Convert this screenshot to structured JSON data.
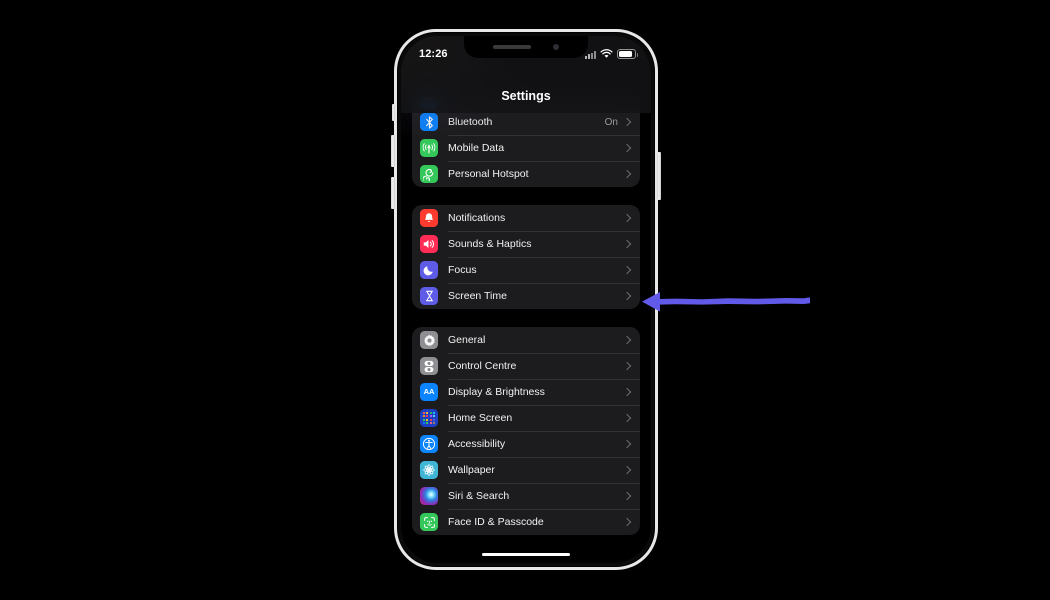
{
  "device": {
    "name": "iphone-mockup",
    "frame_color": "#e8e8e8"
  },
  "status_bar": {
    "time": "12:26",
    "signal_icon": "cellular-signal-icon",
    "wifi_icon": "wifi-icon",
    "battery_icon": "battery-icon"
  },
  "header": {
    "title": "Settings"
  },
  "groups": [
    {
      "name": "connectivity-group",
      "clipped_top": true,
      "rows": [
        {
          "label": "",
          "icon": "wifi-icon",
          "icon_class": "ic-wifi",
          "glyph": "◔",
          "value": "",
          "partial": true
        },
        {
          "label": "Bluetooth",
          "icon": "bluetooth-icon",
          "icon_class": "ic-bluetooth",
          "glyph": "ᛦ",
          "value": "On"
        },
        {
          "label": "Mobile Data",
          "icon": "mobile-data-icon",
          "icon_class": "ic-cellular",
          "glyph": "((↑))",
          "value": ""
        },
        {
          "label": "Personal Hotspot",
          "icon": "personal-hotspot-icon",
          "icon_class": "ic-hotspot",
          "glyph": "ʘ",
          "value": ""
        }
      ]
    },
    {
      "name": "notifications-group",
      "clipped_top": false,
      "rows": [
        {
          "label": "Notifications",
          "icon": "bell-icon",
          "icon_class": "ic-notif",
          "glyph": "🔔",
          "value": ""
        },
        {
          "label": "Sounds & Haptics",
          "icon": "speaker-icon",
          "icon_class": "ic-sounds",
          "glyph": "🔊",
          "value": ""
        },
        {
          "label": "Focus",
          "icon": "moon-icon",
          "icon_class": "ic-focus",
          "glyph": "☾",
          "value": ""
        },
        {
          "label": "Screen Time",
          "icon": "hourglass-icon",
          "icon_class": "ic-screentime",
          "glyph": "⧖",
          "value": ""
        }
      ]
    },
    {
      "name": "system-group",
      "clipped_top": false,
      "rows": [
        {
          "label": "General",
          "icon": "gear-icon",
          "icon_class": "ic-general",
          "glyph": "⚙",
          "value": ""
        },
        {
          "label": "Control Centre",
          "icon": "sliders-icon",
          "icon_class": "ic-control",
          "glyph": "≡",
          "value": ""
        },
        {
          "label": "Display & Brightness",
          "icon": "text-size-icon",
          "icon_class": "ic-display",
          "glyph": "AA",
          "value": ""
        },
        {
          "label": "Home Screen",
          "icon": "app-grid-icon",
          "icon_class": "ic-homescr",
          "glyph": "",
          "value": ""
        },
        {
          "label": "Accessibility",
          "icon": "accessibility-icon",
          "icon_class": "ic-access",
          "glyph": "Ⓙ",
          "value": ""
        },
        {
          "label": "Wallpaper",
          "icon": "flower-icon",
          "icon_class": "ic-wallpaper",
          "glyph": "❁",
          "value": ""
        },
        {
          "label": "Siri & Search",
          "icon": "siri-orb-icon",
          "icon_class": "ic-siri",
          "glyph": "",
          "value": ""
        },
        {
          "label": "Face ID & Passcode",
          "icon": "face-id-icon",
          "icon_class": "ic-faceid",
          "glyph": "□",
          "value": ""
        }
      ]
    }
  ],
  "annotation": {
    "type": "arrow",
    "direction": "left",
    "color": "#6159e8",
    "points_to": "Screen Time"
  }
}
